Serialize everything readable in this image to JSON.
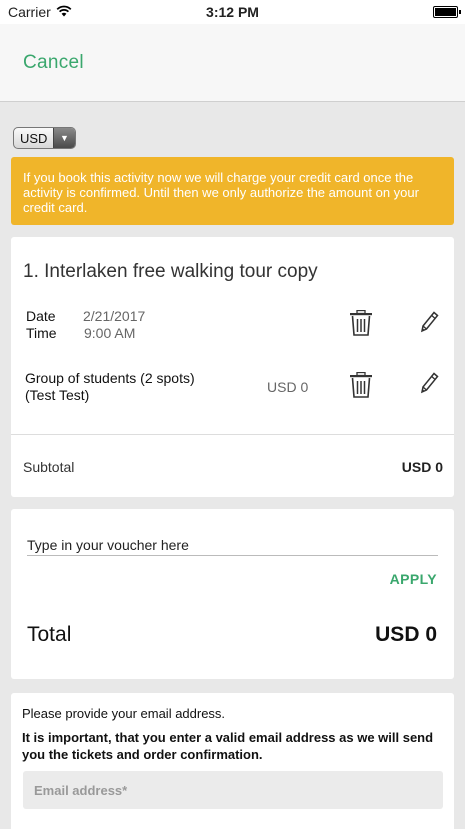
{
  "status_bar": {
    "carrier": "Carrier",
    "time": "3:12 PM"
  },
  "nav": {
    "cancel_label": "Cancel"
  },
  "currency": {
    "selected": "USD"
  },
  "notice": {
    "text": "If you book this activity now we will charge your credit card once the activity is confirmed. Until then we only authorize the amount on your credit card.",
    "color": "#f0b52a"
  },
  "booking": {
    "title": "1. Interlaken free walking tour copy",
    "date_label": "Date",
    "date_value": "2/21/2017",
    "time_label": "Time",
    "time_value": "9:00 AM",
    "group_line1": "Group of students (2 spots)",
    "group_line2": "(Test Test)",
    "group_price": "USD 0",
    "subtotal_label": "Subtotal",
    "subtotal_value": "USD 0"
  },
  "voucher": {
    "placeholder": "Type in your voucher here",
    "apply_label": "APPLY"
  },
  "total": {
    "label": "Total",
    "value": "USD 0"
  },
  "email": {
    "prompt": "Please provide your email address.",
    "note": "It is important, that you enter a valid email address as we will send you the tickets and order confirmation.",
    "placeholder": "Email address*"
  },
  "icons": [
    "wifi-icon",
    "battery-icon",
    "dropdown-arrow-icon",
    "trash-icon",
    "pencil-icon"
  ],
  "colors": {
    "accent": "#3aa76d",
    "warning": "#f0b52a"
  }
}
